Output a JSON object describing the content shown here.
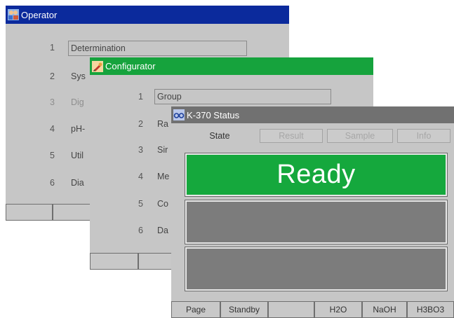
{
  "operator": {
    "title": "Operator",
    "icon": "operator-icon",
    "menu": [
      {
        "num": "1",
        "label": "Determination"
      },
      {
        "num": "2",
        "label": "Sys"
      },
      {
        "num": "3",
        "label": "Dig"
      },
      {
        "num": "4",
        "label": "pH-"
      },
      {
        "num": "5",
        "label": "Util"
      },
      {
        "num": "6",
        "label": "Dia"
      }
    ]
  },
  "configurator": {
    "title": "Configurator",
    "icon": "wrench-icon",
    "menu": [
      {
        "num": "1",
        "label": "Group"
      },
      {
        "num": "2",
        "label": "Ra"
      },
      {
        "num": "3",
        "label": "Sir"
      },
      {
        "num": "4",
        "label": "Me"
      },
      {
        "num": "5",
        "label": "Co"
      },
      {
        "num": "6",
        "label": "Da"
      }
    ]
  },
  "status": {
    "title": "K-370 Status",
    "icon": "glasses-icon",
    "tabs": [
      "State",
      "Result",
      "Sample",
      "Info"
    ],
    "ready_text": "Ready",
    "fkeys": [
      "Page",
      "Standby",
      "",
      "H2O",
      "NaOH",
      "H3BO3"
    ]
  },
  "colors": {
    "operator_title": "#0b2a9c",
    "configurator_title": "#16a33d",
    "status_title": "#717171",
    "ready_green": "#15a83d",
    "panel_grey": "#7c7c7c",
    "window_bg": "#c6c6c6"
  }
}
